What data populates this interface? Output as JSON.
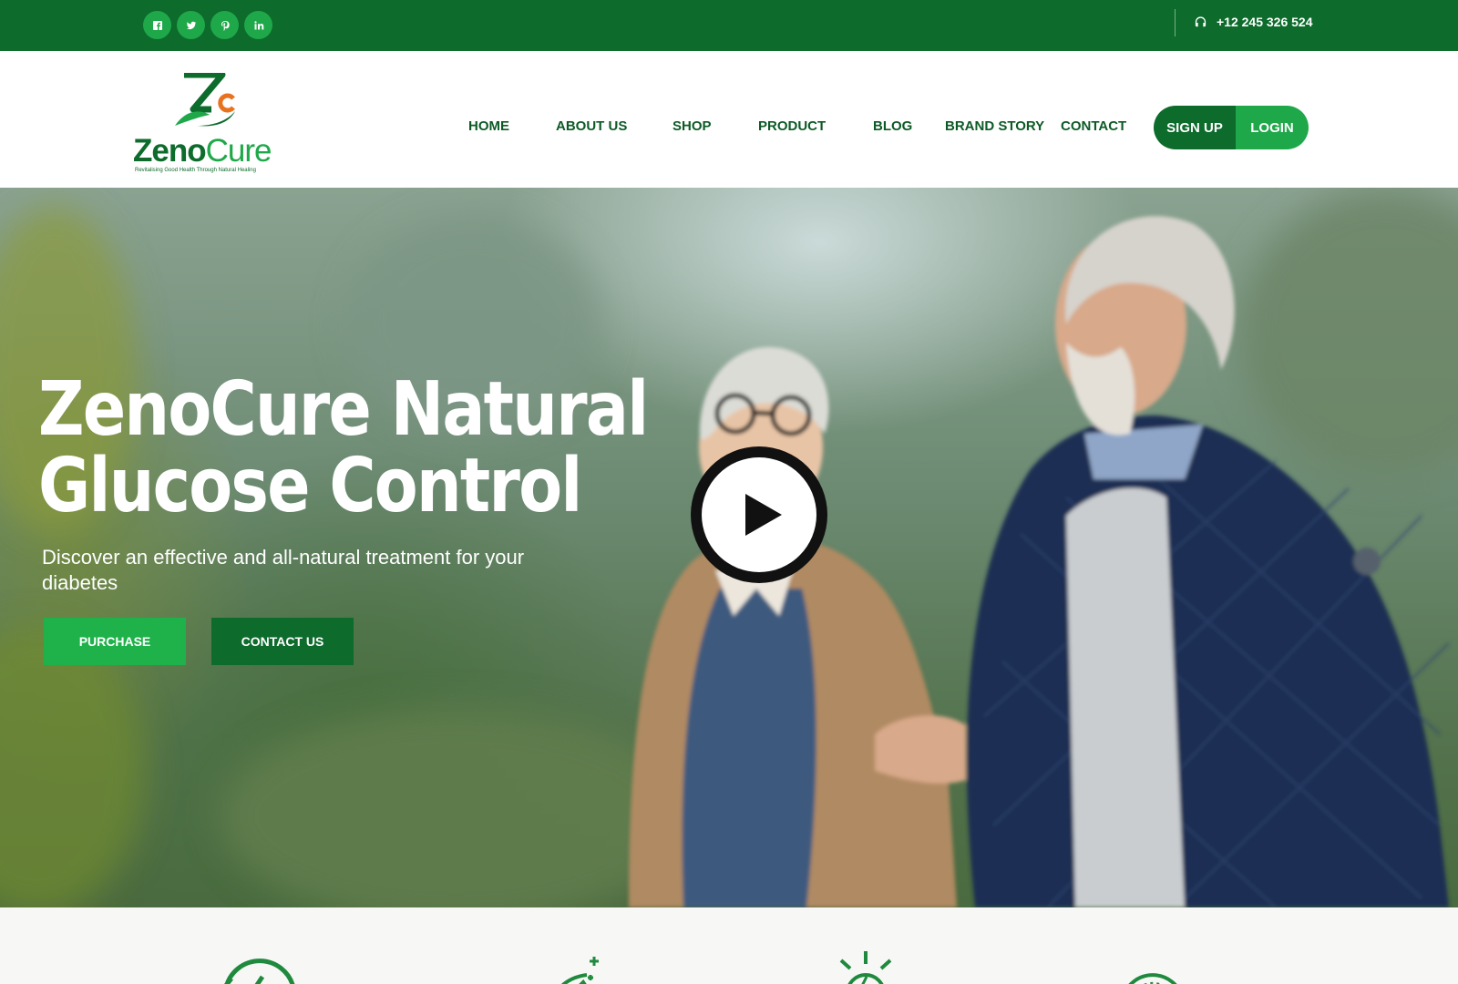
{
  "topbar": {
    "socials": [
      {
        "icon": "facebook-icon"
      },
      {
        "icon": "twitter-icon"
      },
      {
        "icon": "pinterest-icon"
      },
      {
        "icon": "linkedin-icon"
      }
    ],
    "phone_icon": "headset-icon",
    "phone": "+12 245 326 524"
  },
  "header": {
    "logo": {
      "brand_part1": "Zeno",
      "brand_part2": "Cure",
      "tagline": "Revitalising Good Health Through Natural Healing"
    },
    "nav": [
      "HOME",
      "ABOUT US",
      "SHOP",
      "PRODUCT",
      "BLOG",
      "BRAND STORY",
      "CONTACT"
    ],
    "signup": "SIGN UP",
    "login": "LOGIN"
  },
  "hero": {
    "title_line1": "ZenoCure Natural",
    "title_line2": "Glucose Control",
    "subtitle": "Discover an effective and all-natural treatment for your diabetes",
    "purchase_button": "PURCHASE",
    "contact_button": "CONTACT US",
    "play_icon": "play-icon"
  },
  "features": {
    "icons": [
      "clock-check-icon",
      "leaf-plus-icon",
      "lightbulb-icon",
      "gauge-icon"
    ]
  },
  "colors": {
    "dark_green": "#0d6b2c",
    "bright_green": "#1fa84a",
    "accent_orange": "#e8731f"
  }
}
